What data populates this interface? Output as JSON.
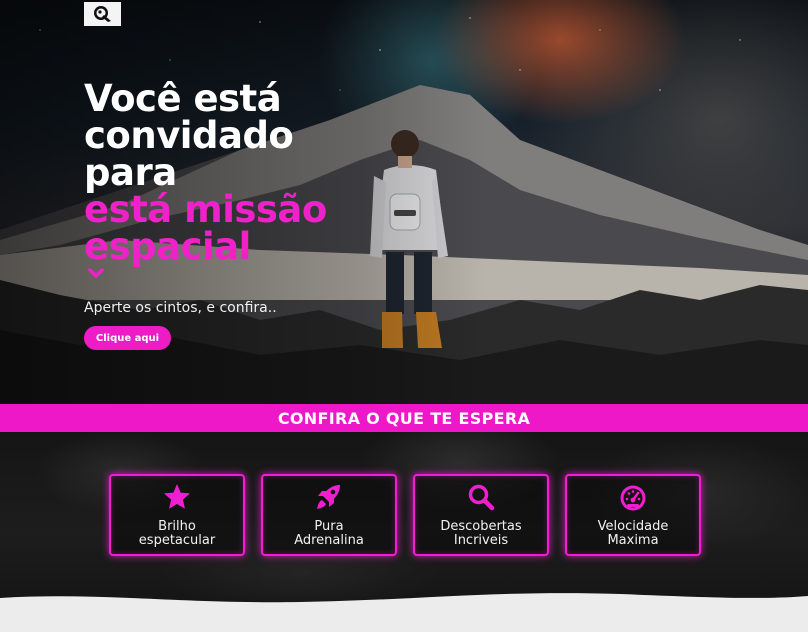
{
  "logo": {
    "icon": "astronaut-logo-icon"
  },
  "hero": {
    "headline_line1": "Você está",
    "headline_line2": "convidado",
    "headline_line3": "para",
    "headline_pink_line1": "está missão",
    "headline_pink_line2": "espacial",
    "subtitle": "Aperte os cintos, e confira..",
    "cta_label": "Clique aqui"
  },
  "banner": {
    "title": "CONFIRA O QUE TE ESPERA"
  },
  "features": [
    {
      "line1": "Brilho",
      "line2": "espetacular",
      "icon": "star-icon"
    },
    {
      "line1": "Pura",
      "line2": "Adrenalina",
      "icon": "rocket-icon"
    },
    {
      "line1": "Descobertas",
      "line2": "Incriveis",
      "icon": "search-icon"
    },
    {
      "line1": "Velocidade",
      "line2": "Maxima",
      "icon": "speedometer-icon"
    }
  ],
  "colors": {
    "accent": "#ee18c8",
    "text": "#ffffff",
    "dark": "#151515"
  }
}
